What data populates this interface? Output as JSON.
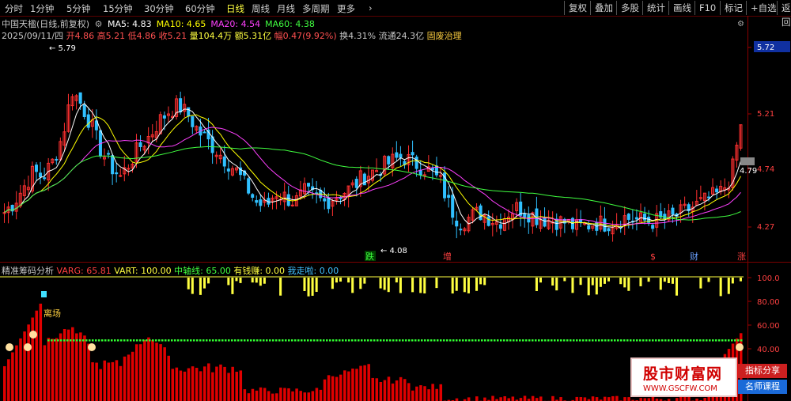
{
  "toolbar": {
    "periods": [
      "分时",
      "1分钟",
      "5分钟",
      "15分钟",
      "30分钟",
      "60分钟",
      "日线",
      "周线",
      "月线",
      "多周期",
      "更多"
    ],
    "active_period": "日线",
    "more_arrow": "›",
    "right_buttons": [
      "复权",
      "叠加",
      "多股",
      "统计",
      "画线",
      "F10",
      "标记",
      "+自选",
      "返回"
    ]
  },
  "header": {
    "stock_title": "中国天楹(日线,前复权)",
    "ma": [
      {
        "label": "MA5: 4.83",
        "color": "#ffffff"
      },
      {
        "label": "MA10: 4.65",
        "color": "#ffff00"
      },
      {
        "label": "MA20: 4.54",
        "color": "#ff40ff"
      },
      {
        "label": "MA60: 4.38",
        "color": "#40ff40"
      }
    ],
    "date": "2025/09/11/四",
    "open": "开4.86",
    "high": "高5.21",
    "low": "低4.86",
    "close": "收5.21",
    "volume": "量104.4万",
    "amount": "额5.31亿",
    "amplitude": "幅0.47(9.92%)",
    "turnover": "换4.31%",
    "float": "流通24.3亿",
    "concept": "固废治理"
  },
  "price_panel": {
    "price_tag": "5.72",
    "hover_price": "4.79",
    "high_label": "5.79",
    "low_label": "4.08",
    "y_ticks": [
      "5.72",
      "5.21",
      "4.74",
      "4.27"
    ],
    "markers": [
      {
        "text": "跌",
        "color": "#40ff40",
        "bg": "#000"
      },
      {
        "text": "增",
        "color": "#ff4040"
      },
      {
        "text": "$",
        "color": "#ff4040"
      },
      {
        "text": "财",
        "color": "#6aa0ff"
      },
      {
        "text": "涨",
        "color": "#ff4040"
      }
    ]
  },
  "indicator": {
    "name": "精准筹码分析",
    "varg": "VARG: 65.81",
    "vart": "VART: 100.00",
    "axis": "中轴线: 65.00",
    "money": "有钱赚: 0.00",
    "leave": "我走啦: 0.00",
    "hot_label": "离场",
    "y_ticks": [
      "100.0",
      "80.00",
      "60.00",
      "40.00"
    ]
  },
  "watermark": {
    "title": "股市财富网",
    "url": "WWW.GSCFW.COM",
    "tag1": "指标分享",
    "tag2": "名师课程"
  },
  "chart_data": {
    "type": "candlestick+indicator",
    "price_ylim": [
      3.95,
      6.0
    ],
    "indicator_ylim": [
      30,
      105
    ],
    "candles_close": [
      4.35,
      4.45,
      4.6,
      4.75,
      4.7,
      4.85,
      5.1,
      5.55,
      5.4,
      5.2,
      4.95,
      4.8,
      4.7,
      4.85,
      5.0,
      5.1,
      5.25,
      5.35,
      5.4,
      5.3,
      5.15,
      5.05,
      4.95,
      4.85,
      4.75,
      4.6,
      4.45,
      4.4,
      4.55,
      4.5,
      4.45,
      4.55,
      4.5,
      4.45,
      4.5,
      4.55,
      4.6,
      4.7,
      4.75,
      4.8,
      4.85,
      4.9,
      4.85,
      4.8,
      4.75,
      4.65,
      4.4,
      4.25,
      4.3,
      4.35,
      4.3,
      4.25,
      4.35,
      4.4,
      4.35,
      4.3,
      4.28,
      4.27,
      4.25,
      4.2,
      4.22,
      4.25,
      4.24,
      4.26,
      4.3,
      4.28,
      4.27,
      4.26,
      4.28,
      4.3,
      4.35,
      4.4,
      4.45,
      4.5,
      4.55,
      4.7,
      5.21
    ],
    "ma60_color": "#40ff40"
  }
}
